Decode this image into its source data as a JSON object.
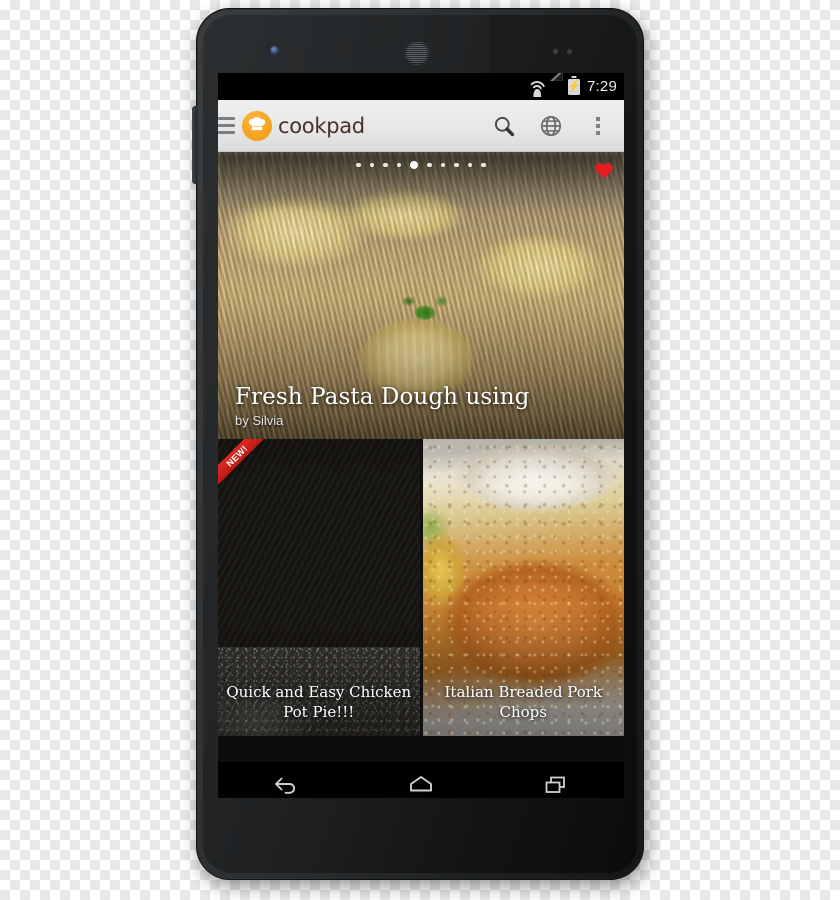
{
  "device": {
    "name": "android-smartphone",
    "hardware": {
      "front_camera": "front-camera",
      "earpiece": "earpiece-speaker",
      "volume_rocker": "volume-rocker",
      "sensors": "proximity-sensors"
    }
  },
  "status_bar": {
    "time": "7:29",
    "icons": [
      "wifi-icon",
      "signal-icon",
      "battery-charging-icon"
    ]
  },
  "app_bar": {
    "menu_icon": "hamburger-menu-icon",
    "brand": "cookpad",
    "brand_logo": "chef-hat-icon",
    "brand_color": "#f5a623",
    "brand_text_color": "#4a2f28",
    "actions": [
      {
        "name": "search",
        "icon": "search-icon"
      },
      {
        "name": "language",
        "icon": "globe-icon"
      },
      {
        "name": "more-options",
        "icon": "overflow-menu-icon"
      }
    ]
  },
  "hero": {
    "title": "Fresh Pasta Dough using",
    "byline": "by Silvia",
    "favorite_icon": "heart-icon",
    "favorite_color": "#e51c23",
    "page_dots_total": 10,
    "page_dots_active_index": 4,
    "image_alt": "fresh pasta nests on a wooden cutting board with parsley"
  },
  "grid": [
    {
      "title": "Quick and Easy Chicken Pot Pie!!!",
      "badge": "NEW!",
      "badge_color": "#d0221c",
      "image_alt": "golden baked chicken pot pie in a glass dish"
    },
    {
      "title": "Italian Breaded Pork Chops",
      "badge": null,
      "image_alt": "breaded pork chop with mashed potatoes and squash"
    }
  ],
  "nav_bar": {
    "buttons": [
      {
        "name": "back",
        "icon": "back-arrow-icon"
      },
      {
        "name": "home",
        "icon": "home-icon"
      },
      {
        "name": "recents",
        "icon": "recent-apps-icon"
      }
    ]
  }
}
